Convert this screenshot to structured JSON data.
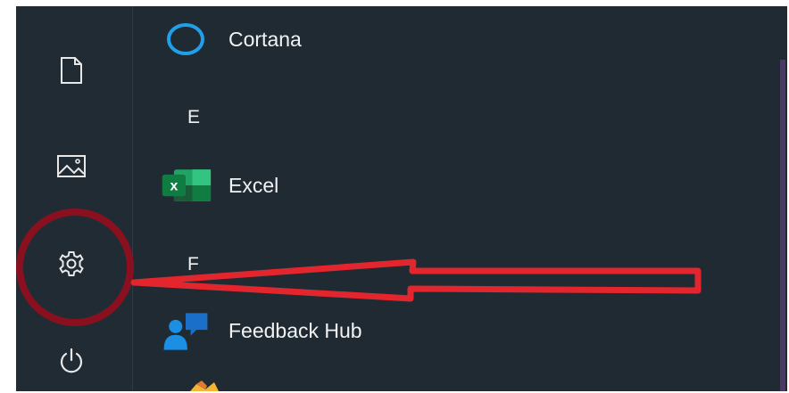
{
  "start_menu": {
    "rail": {
      "documents_icon": "document-icon",
      "pictures_icon": "pictures-icon",
      "settings_icon": "gear-icon",
      "power_icon": "power-icon"
    },
    "apps": [
      {
        "label": "Cortana",
        "icon": "cortana-icon"
      },
      {
        "label": "Excel",
        "icon": "excel-icon"
      },
      {
        "label": "Feedback Hub",
        "icon": "feedback-hub-icon"
      }
    ],
    "group_letters": [
      "E",
      "F"
    ]
  },
  "annotation": {
    "circle_color": "#8a1020",
    "arrow_color": "#e3262e"
  },
  "colors": {
    "background": "#202a33",
    "text": "#f2f2f2",
    "cortana_ring": "#20a0e8",
    "excel_green": "#1e7a45",
    "feedback_blue": "#1a8fe3"
  }
}
